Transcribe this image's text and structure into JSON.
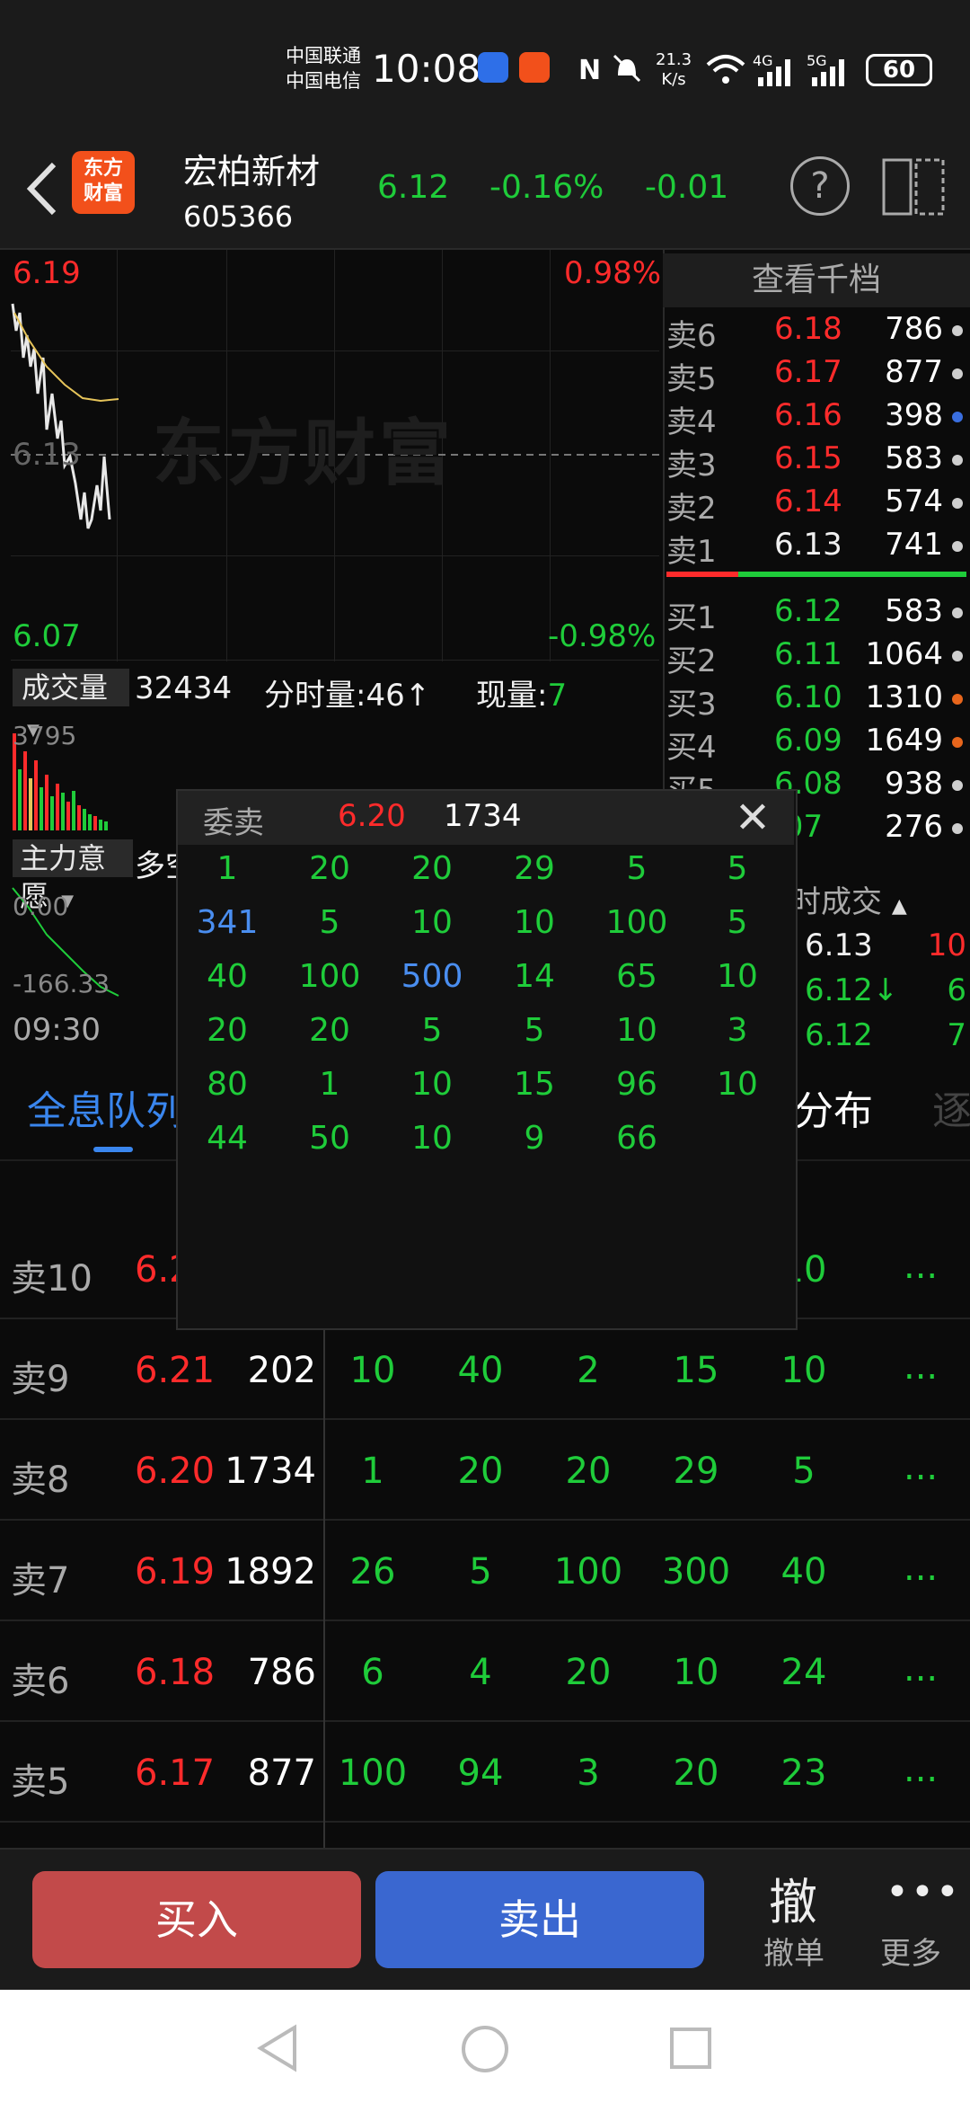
{
  "status_bar": {
    "carrier1": "中国联通",
    "carrier2": "中国电信",
    "time": "10:08",
    "net_speed_value": "21.3",
    "net_speed_unit": "K/s",
    "signal1": "4G",
    "signal2": "5G",
    "battery": "60"
  },
  "header": {
    "logo_text1": "东方",
    "logo_text2": "财富",
    "stock_name": "宏柏新材",
    "stock_code": "605366",
    "price": "6.12",
    "change_pct": "-0.16%",
    "change": "-0.01",
    "help_icon": "?"
  },
  "chart": {
    "y_high": "6.19",
    "y_mid": "6.13",
    "y_low": "6.07",
    "pct_high": "0.98%",
    "pct_low": "-0.98%",
    "watermark": "东方财富",
    "volume_tag": "成交量",
    "volume_value": "32434",
    "fsl_label": "分时量:46↑",
    "xl_label": "现量:",
    "xl_value": "7",
    "volume_max": "3795",
    "zl_tag": "主力意愿",
    "zl_extra": "多空",
    "zl_top": "0.00",
    "zl_bottom": "-166.33",
    "time_label": "09:30"
  },
  "order_book": {
    "title": "查看千档",
    "asks": [
      {
        "label": "卖6",
        "price": "6.18",
        "qty": "786",
        "dot": "#cfcfcf",
        "pcolor": "red"
      },
      {
        "label": "卖5",
        "price": "6.17",
        "qty": "877",
        "dot": "#cfcfcf",
        "pcolor": "red"
      },
      {
        "label": "卖4",
        "price": "6.16",
        "qty": "398",
        "dot": "#3a6fe0",
        "pcolor": "red"
      },
      {
        "label": "卖3",
        "price": "6.15",
        "qty": "583",
        "dot": "#cfcfcf",
        "pcolor": "red"
      },
      {
        "label": "卖2",
        "price": "6.14",
        "qty": "574",
        "dot": "#cfcfcf",
        "pcolor": "red"
      },
      {
        "label": "卖1",
        "price": "6.13",
        "qty": "741",
        "dot": "#cfcfcf",
        "pcolor": "white"
      }
    ],
    "bids": [
      {
        "label": "买1",
        "price": "6.12",
        "qty": "583",
        "dot": "#cfcfcf"
      },
      {
        "label": "买2",
        "price": "6.11",
        "qty": "1064",
        "dot": "#cfcfcf"
      },
      {
        "label": "买3",
        "price": "6.10",
        "qty": "1310",
        "dot": "#e8661c"
      },
      {
        "label": "买4",
        "price": "6.09",
        "qty": "1649",
        "dot": "#e8661c"
      },
      {
        "label": "买5",
        "price": "6.08",
        "qty": "938",
        "dot": "#cfcfcf"
      },
      {
        "label": "",
        "price": ".07",
        "qty": "276",
        "dot": "#cfcfcf"
      }
    ],
    "trades_title": "时成交",
    "trades": [
      {
        "price": "6.13",
        "pcolor": "white",
        "qty": "10",
        "qcolor": "red"
      },
      {
        "price": "6.12↓",
        "pcolor": "green",
        "qty": "6",
        "qcolor": "green"
      },
      {
        "price": "6.12",
        "pcolor": "green",
        "qty": "7",
        "qcolor": "green"
      }
    ]
  },
  "tabs": {
    "queue": "全息队列",
    "dist": "分布",
    "next": "逐"
  },
  "queue_rows": [
    {
      "label": "卖10",
      "price": "6.2",
      "qty": "",
      "cells": [
        "",
        "",
        "",
        "",
        "10"
      ]
    },
    {
      "label": "卖9",
      "price": "6.21",
      "qty": "202",
      "cells": [
        "10",
        "40",
        "2",
        "15",
        "10"
      ]
    },
    {
      "label": "卖8",
      "price": "6.20",
      "qty": "1734",
      "cells": [
        "1",
        "20",
        "20",
        "29",
        "5"
      ]
    },
    {
      "label": "卖7",
      "price": "6.19",
      "qty": "1892",
      "cells": [
        "26",
        "5",
        "100",
        "300",
        "40"
      ]
    },
    {
      "label": "卖6",
      "price": "6.18",
      "qty": "786",
      "cells": [
        "6",
        "4",
        "20",
        "10",
        "24"
      ]
    },
    {
      "label": "卖5",
      "price": "6.17",
      "qty": "877",
      "cells": [
        "100",
        "94",
        "3",
        "20",
        "23"
      ]
    }
  ],
  "queue_more": "...",
  "popup": {
    "title": "委卖",
    "price": "6.20",
    "qty": "1734",
    "close": "✕",
    "rows": [
      [
        {
          "v": "1",
          "c": "green"
        },
        {
          "v": "20",
          "c": "green"
        },
        {
          "v": "20",
          "c": "green"
        },
        {
          "v": "29",
          "c": "green"
        },
        {
          "v": "5",
          "c": "green"
        },
        {
          "v": "5",
          "c": "green"
        }
      ],
      [
        {
          "v": "341",
          "c": "blue"
        },
        {
          "v": "5",
          "c": "green"
        },
        {
          "v": "10",
          "c": "green"
        },
        {
          "v": "10",
          "c": "green"
        },
        {
          "v": "100",
          "c": "green"
        },
        {
          "v": "5",
          "c": "green"
        }
      ],
      [
        {
          "v": "40",
          "c": "green"
        },
        {
          "v": "100",
          "c": "green"
        },
        {
          "v": "500",
          "c": "blue"
        },
        {
          "v": "14",
          "c": "green"
        },
        {
          "v": "65",
          "c": "green"
        },
        {
          "v": "10",
          "c": "green"
        }
      ],
      [
        {
          "v": "20",
          "c": "green"
        },
        {
          "v": "20",
          "c": "green"
        },
        {
          "v": "5",
          "c": "green"
        },
        {
          "v": "5",
          "c": "green"
        },
        {
          "v": "10",
          "c": "green"
        },
        {
          "v": "3",
          "c": "green"
        }
      ],
      [
        {
          "v": "80",
          "c": "green"
        },
        {
          "v": "1",
          "c": "green"
        },
        {
          "v": "10",
          "c": "green"
        },
        {
          "v": "15",
          "c": "green"
        },
        {
          "v": "96",
          "c": "green"
        },
        {
          "v": "10",
          "c": "green"
        }
      ],
      [
        {
          "v": "44",
          "c": "green"
        },
        {
          "v": "50",
          "c": "green"
        },
        {
          "v": "10",
          "c": "green"
        },
        {
          "v": "9",
          "c": "green"
        },
        {
          "v": "66",
          "c": "green"
        },
        {
          "v": "",
          "c": "green"
        }
      ]
    ]
  },
  "actions": {
    "buy": "买入",
    "sell": "卖出",
    "cancel_icon": "撤",
    "cancel_label": "撤单",
    "more_icon": "•••",
    "more_label": "更多"
  },
  "colors": {
    "up": "#ff2b2b",
    "down": "#1fcc3a",
    "accent": "#3a86ee",
    "buy": "#c24a4a",
    "sell": "#3a67d0"
  }
}
